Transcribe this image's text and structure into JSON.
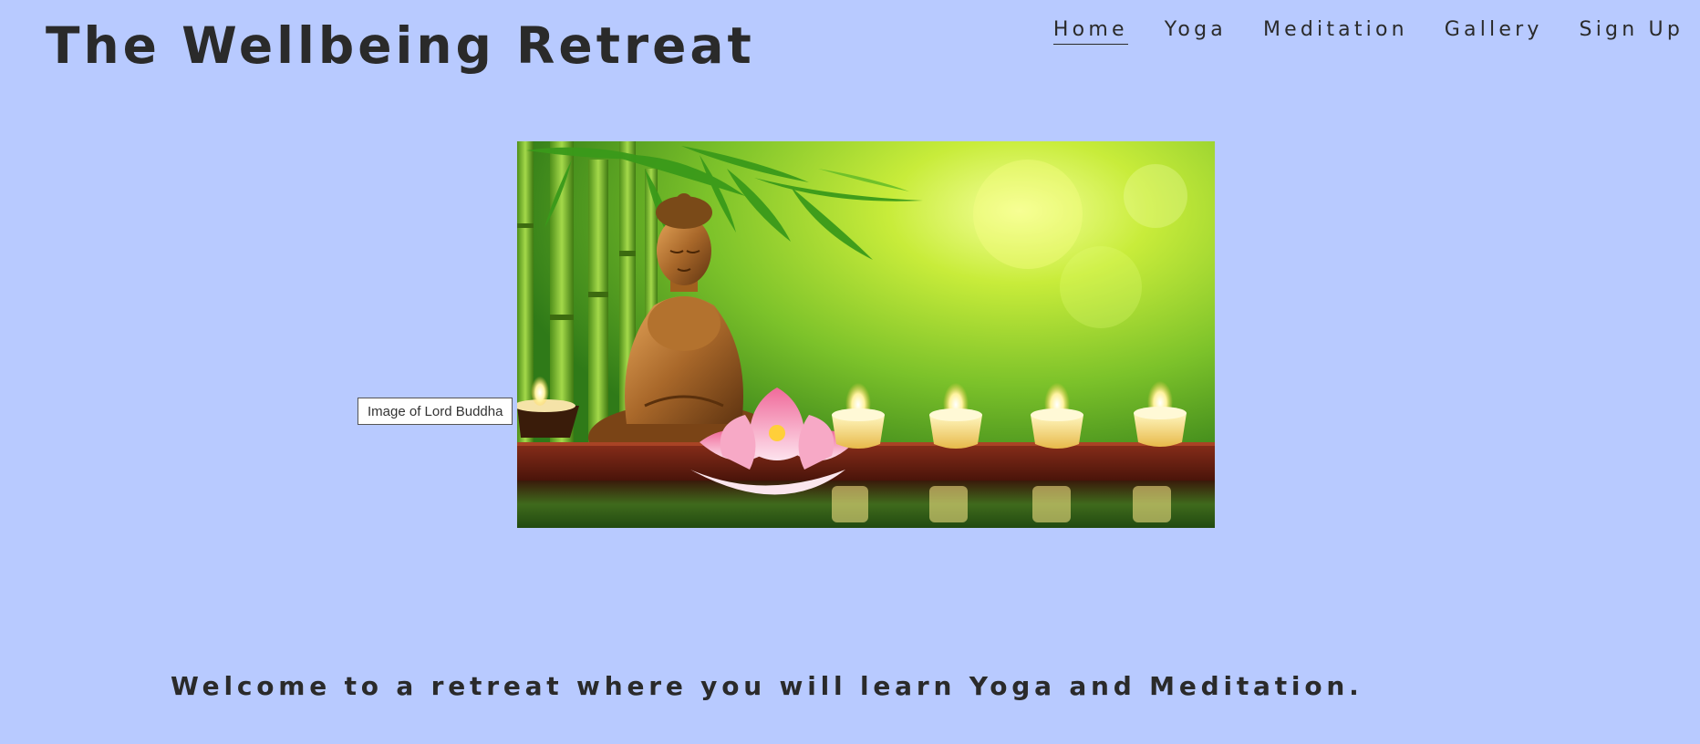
{
  "header": {
    "site_title": "The Wellbeing Retreat"
  },
  "nav": {
    "items": [
      {
        "label": "Home",
        "active": true
      },
      {
        "label": "Yoga",
        "active": false
      },
      {
        "label": "Meditation",
        "active": false
      },
      {
        "label": "Gallery",
        "active": false
      },
      {
        "label": "Sign Up",
        "active": false
      }
    ]
  },
  "hero": {
    "alt_text": "Image of Lord Buddha",
    "tooltip": "Image of Lord Buddha"
  },
  "main": {
    "welcome_text": "Welcome to a retreat where you will learn Yoga and Meditation."
  },
  "colors": {
    "background": "#b8caff",
    "text": "#2a2a2a"
  }
}
